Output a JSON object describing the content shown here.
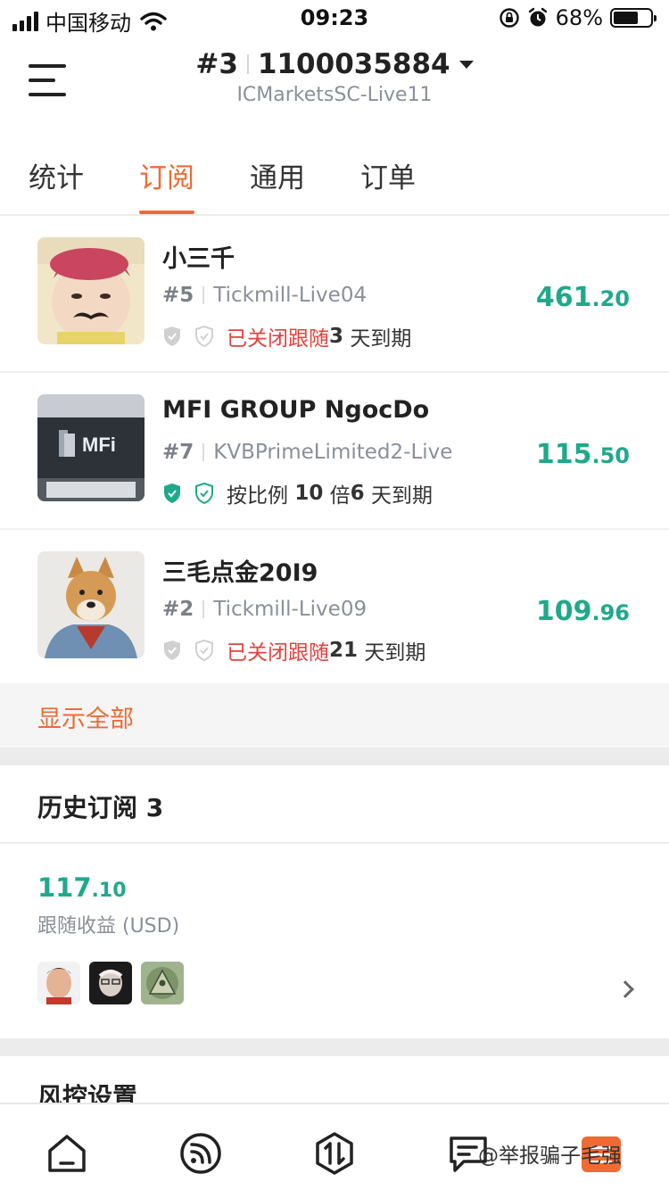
{
  "status_bar": {
    "carrier": "中国移动",
    "time": "09:23",
    "battery": "68%",
    "battery_level": 0.68,
    "icons": [
      "signal-icon",
      "wifi-icon",
      "rotation-lock-icon",
      "alarm-icon",
      "battery-icon"
    ]
  },
  "header": {
    "rank": "#3",
    "account": "1100035884",
    "server": "ICMarketsSC-Live11"
  },
  "tabs": [
    {
      "label": "统计"
    },
    {
      "label": "订阅"
    },
    {
      "label": "通用"
    },
    {
      "label": "订单"
    }
  ],
  "active_tab": "订阅",
  "subscriptions": [
    {
      "name": "小三千",
      "rank": "#5",
      "server": "Tickmill-Live04",
      "status": "已关闭跟随",
      "days": "3",
      "days_suffix": " 天到期",
      "value_int": "461",
      "value_dec": ".20",
      "shield_color": "#d0d0d0"
    },
    {
      "name": "MFI GROUP NgocDo",
      "rank": "#7",
      "server": "KVBPrimeLimited2-Live",
      "status_prefix": "按比例 ",
      "ratio": "10",
      "ratio_suffix": " 倍",
      "days": "6",
      "days_suffix": " 天到期",
      "value_int": "115",
      "value_dec": ".50",
      "shield_color": "#1fa98a"
    },
    {
      "name": "三毛点金20I9",
      "rank": "#2",
      "server": "Tickmill-Live09",
      "status": "已关闭跟随",
      "days": "21",
      "days_suffix": " 天到期",
      "value_int": "109",
      "value_dec": ".96",
      "shield_color": "#d0d0d0"
    }
  ],
  "show_all": "显示全部",
  "history": {
    "title": "历史订阅 3",
    "value_int": "117",
    "value_dec": ".10",
    "label": "跟随收益 (USD)"
  },
  "risk_title": "风控设置",
  "bottom_nav": {
    "items": [
      "home-icon",
      "feed-icon",
      "trade-icon",
      "message-icon"
    ],
    "watermark": "@举报骗子毛强"
  },
  "colors": {
    "accent": "#ee6b34",
    "profit": "#1fa98a",
    "closed": "#e0433f",
    "muted": "#8a8f99"
  }
}
